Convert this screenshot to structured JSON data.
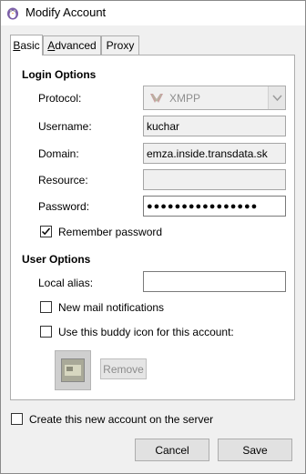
{
  "window": {
    "title": "Modify Account"
  },
  "tabs": [
    {
      "label": "Basic",
      "mnemonic": "B",
      "rest": "asic"
    },
    {
      "label": "Advanced",
      "pre": "",
      "mnemonic": "A",
      "rest": "dvanced"
    },
    {
      "label": "Proxy",
      "pre": "",
      "mnemonic": "x",
      "full": "Proxy"
    }
  ],
  "login_options": {
    "heading": "Login Options",
    "protocol_label": "Protocol:",
    "protocol_value": "XMPP",
    "username_label": "Username:",
    "username_value": "kuchar",
    "domain_label": "Domain:",
    "domain_value": "emza.inside.transdata.sk",
    "resource_label": "Resource:",
    "resource_value": "",
    "password_label": "Password:",
    "password_value": "●●●●●●●●●●●●●●●●",
    "remember_password_label": "Remember password",
    "remember_password_checked": true
  },
  "user_options": {
    "heading": "User Options",
    "local_alias_label": "Local alias:",
    "local_alias_value": "",
    "new_mail_label": "New mail notifications",
    "new_mail_checked": false,
    "buddy_icon_label": "Use this buddy icon for this account:",
    "buddy_icon_checked": false,
    "remove_label": "Remove"
  },
  "footer": {
    "create_account_label": "Create this new account on the server",
    "create_account_checked": false,
    "cancel_label": "Cancel",
    "save_label": "Save"
  }
}
